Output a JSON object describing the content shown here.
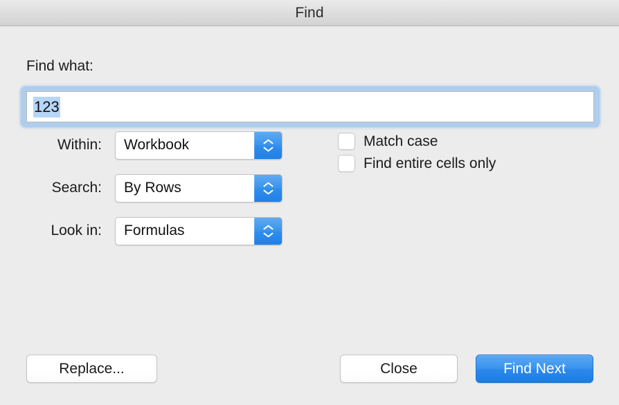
{
  "window": {
    "title": "Find"
  },
  "search": {
    "label": "Find what:",
    "value": "123",
    "placeholder": ""
  },
  "options": [
    {
      "label": "Within:",
      "value": "Workbook",
      "name": "within"
    },
    {
      "label": "Search:",
      "value": "By Rows",
      "name": "search-direction"
    },
    {
      "label": "Look in:",
      "value": "Formulas",
      "name": "look-in"
    }
  ],
  "checkboxes": [
    {
      "label": "Match case",
      "checked": false,
      "name": "match-case"
    },
    {
      "label": "Find entire cells only",
      "checked": false,
      "name": "find-entire-cells-only"
    }
  ],
  "buttons": {
    "replace": "Replace...",
    "close": "Close",
    "find_next": "Find Next"
  },
  "colors": {
    "accent_blue": "#2c89eb",
    "selection_blue": "#b6d6f7",
    "focus_ring": "#7db4ee",
    "window_bg": "#ececec",
    "titlebar_bg": "#dedede"
  },
  "icons": {
    "stepper": "chevron-up-down-icon"
  }
}
